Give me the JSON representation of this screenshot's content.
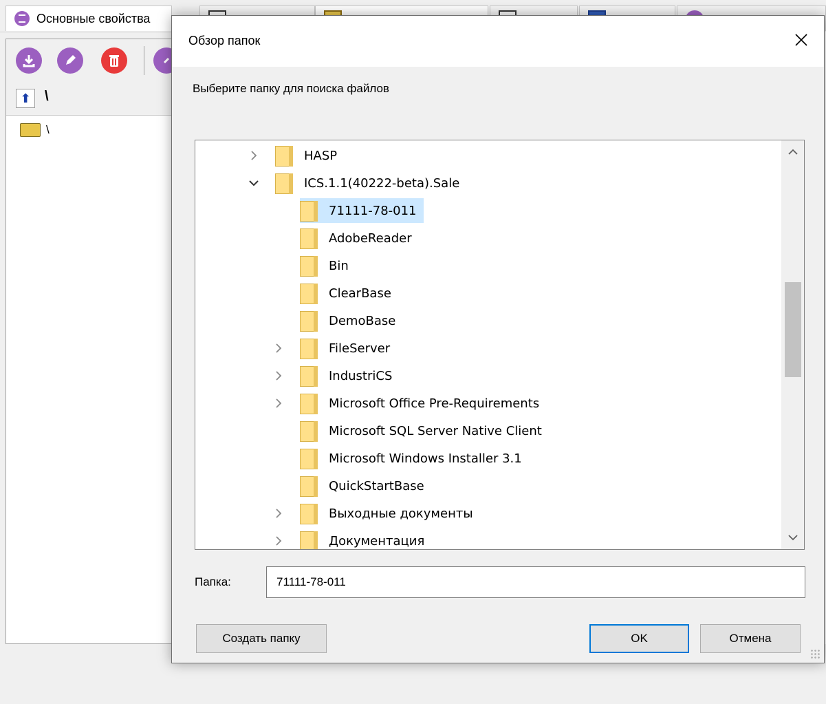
{
  "background_app": {
    "tabs": [
      {
        "label": "Основные свойства"
      },
      {
        "label": ""
      },
      {
        "label": ""
      },
      {
        "label": ""
      },
      {
        "label": ""
      },
      {
        "label": ""
      }
    ],
    "toolbar": {
      "download_icon": "download-icon",
      "edit_icon": "pencil-icon",
      "delete_icon": "trash-icon",
      "link_icon": "link-icon"
    },
    "path_text": "\\",
    "tree_root_label": "\\"
  },
  "dialog": {
    "title": "Обзор папок",
    "instruction": "Выберите папку для поиска файлов",
    "tree": [
      {
        "label": "HASP",
        "level": 0,
        "chevron": "right",
        "selected": false
      },
      {
        "label": "ICS.1.1(40222-beta).Sale",
        "level": 0,
        "chevron": "down",
        "selected": false
      },
      {
        "label": "71111-78-011",
        "level": 1,
        "chevron": "none",
        "selected": true
      },
      {
        "label": "AdobeReader",
        "level": 1,
        "chevron": "none",
        "selected": false
      },
      {
        "label": "Bin",
        "level": 1,
        "chevron": "none",
        "selected": false
      },
      {
        "label": "ClearBase",
        "level": 1,
        "chevron": "none",
        "selected": false
      },
      {
        "label": "DemoBase",
        "level": 1,
        "chevron": "none",
        "selected": false
      },
      {
        "label": "FileServer",
        "level": 1,
        "chevron": "right",
        "selected": false
      },
      {
        "label": "IndustriCS",
        "level": 1,
        "chevron": "right",
        "selected": false
      },
      {
        "label": "Microsoft Office Pre-Requirements",
        "level": 1,
        "chevron": "right",
        "selected": false
      },
      {
        "label": "Microsoft SQL Server Native Client",
        "level": 1,
        "chevron": "none",
        "selected": false
      },
      {
        "label": "Microsoft Windows Installer 3.1",
        "level": 1,
        "chevron": "none",
        "selected": false
      },
      {
        "label": "QuickStartBase",
        "level": 1,
        "chevron": "none",
        "selected": false
      },
      {
        "label": "Выходные документы",
        "level": 1,
        "chevron": "right",
        "selected": false
      },
      {
        "label": "Документация",
        "level": 1,
        "chevron": "right",
        "selected": false
      }
    ],
    "folder_label": "Папка:",
    "folder_value": "71111-78-011",
    "buttons": {
      "create_folder": "Создать папку",
      "ok": "OK",
      "cancel": "Отмена"
    }
  },
  "colors": {
    "selection": "#cce8ff",
    "default_button_border": "#0078d7",
    "folder_yellow": "#ffe08a",
    "purple_icon": "#9b5fc0",
    "red_icon": "#e83a3a"
  }
}
